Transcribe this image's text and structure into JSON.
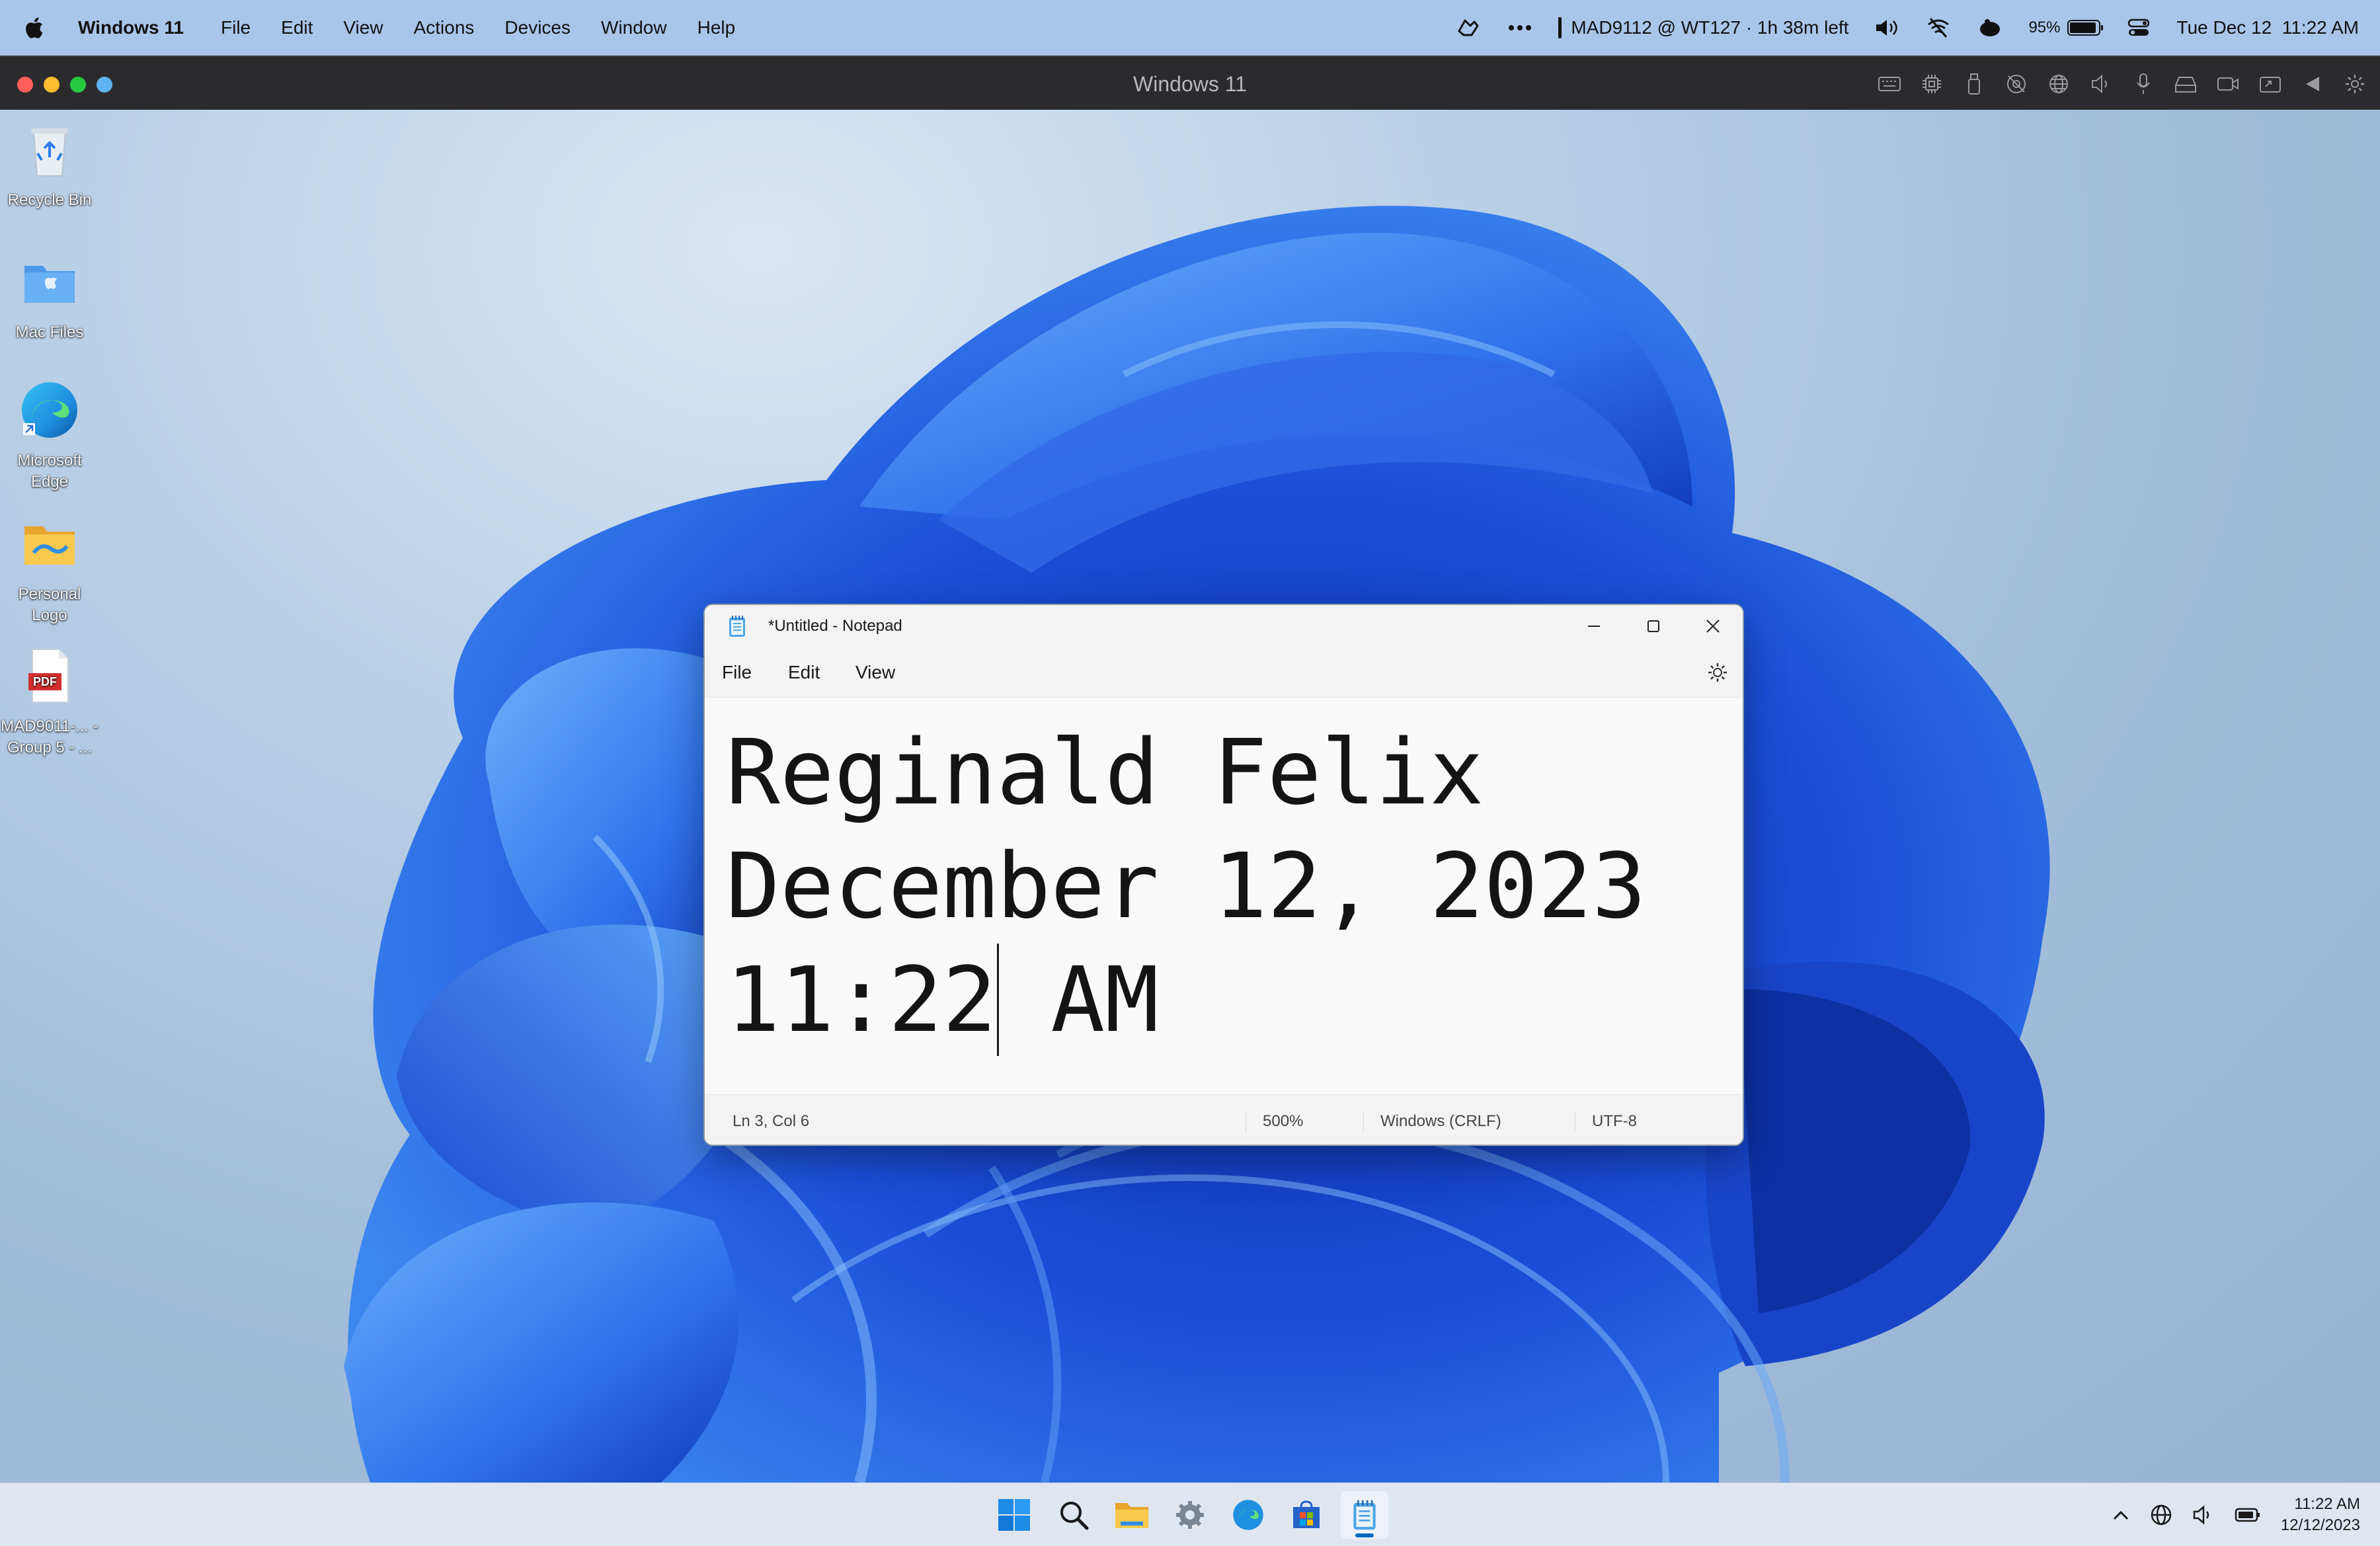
{
  "mac_menubar": {
    "app_name": "Windows 11",
    "menus": [
      "File",
      "Edit",
      "View",
      "Actions",
      "Devices",
      "Window",
      "Help"
    ],
    "status_text": "MAD9112 @ WT127 · 1h 38m left",
    "battery_percent": "95%",
    "battery_level": 0.95,
    "datetime": "Tue Dec 12  11:22 AM"
  },
  "vm_window": {
    "title": "Windows 11",
    "traffic_colors": [
      "#ff5f57",
      "#febc2e",
      "#28c840",
      "#5fb3f0"
    ],
    "toolbar_icons": [
      "keyboard-icon",
      "cpu-icon",
      "usb-icon",
      "camera-off-icon",
      "network-icon",
      "volume-icon",
      "microphone-icon",
      "printer-icon",
      "video-icon",
      "share-icon",
      "arrow-icon",
      "settings-icon"
    ]
  },
  "desktop": {
    "icons": [
      {
        "label": "Recycle Bin",
        "icon": "recycle-bin-icon"
      },
      {
        "label": "Mac Files",
        "icon": "mac-folder-icon"
      },
      {
        "label": "Microsoft Edge",
        "icon": "edge-icon"
      },
      {
        "label": "Personal Logo",
        "icon": "folder-icon"
      },
      {
        "label": "MAD9011-... - Group 5 - ...",
        "icon": "pdf-icon"
      }
    ]
  },
  "notepad": {
    "title": "*Untitled - Notepad",
    "menus": [
      "File",
      "Edit",
      "View"
    ],
    "lines": [
      "Reginald Felix",
      "December 12, 2023",
      "11:22",
      " AM"
    ],
    "status": {
      "position": "Ln 3, Col 6",
      "zoom": "500%",
      "line_ending": "Windows (CRLF)",
      "encoding": "UTF-8"
    }
  },
  "taskbar": {
    "apps": [
      "windows-start-icon",
      "search-icon",
      "file-explorer-icon",
      "settings-icon",
      "edge-icon",
      "microsoft-store-icon",
      "notepad-icon"
    ],
    "clock_time": "11:22 AM",
    "clock_date": "12/12/2023"
  },
  "colors": {
    "accent": "#0067c0",
    "bloom_blue": "#1f5ee8"
  }
}
